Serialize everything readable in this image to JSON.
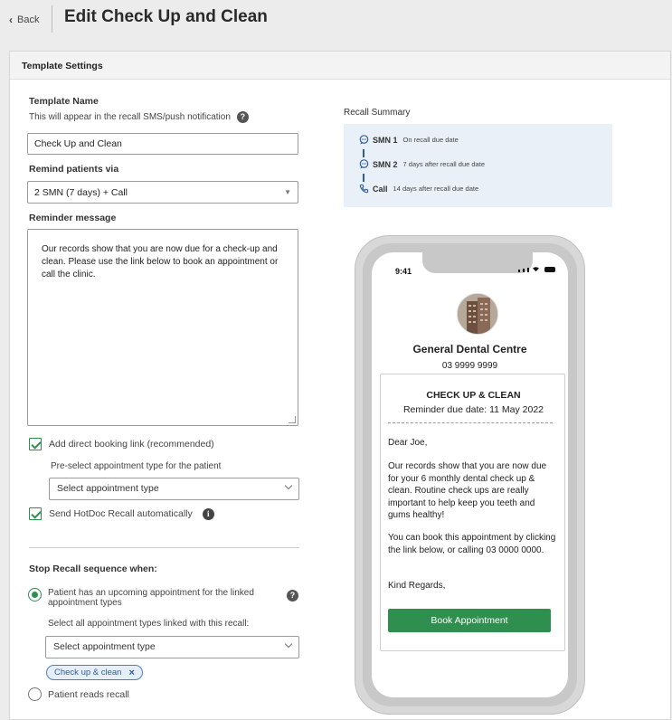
{
  "header": {
    "back_label": "Back",
    "title": "Edit Check Up and Clean"
  },
  "panel": {
    "title": "Template Settings"
  },
  "template_name": {
    "label": "Template Name",
    "help_text": "This will appear in the recall SMS/push notification",
    "value": "Check Up and Clean"
  },
  "remind_via": {
    "label": "Remind patients via",
    "selected": "2 SMN (7 days) + Call"
  },
  "reminder_message": {
    "label": "Reminder message",
    "text": "Our records show that you are now due for a check-up and clean. Please use the link below to book an appointment or call the clinic."
  },
  "booking_link": {
    "checkbox_label": "Add direct booking link (recommended)",
    "preselect_label": "Pre-select appointment type for the patient",
    "preselect_placeholder": "Select appointment type"
  },
  "auto_send": {
    "checkbox_label": "Send HotDoc Recall automatically"
  },
  "stop_recall": {
    "label": "Stop Recall sequence when:",
    "option1_line1": "Patient has an upcoming appointment for the linked",
    "option1_line2": "appointment types",
    "linked_label": "Select all appointment types linked with this recall:",
    "linked_placeholder": "Select appointment type",
    "chips": [
      "Check up & clean"
    ],
    "option2": "Patient reads recall"
  },
  "recall_summary": {
    "title": "Recall Summary",
    "items": [
      {
        "name": "SMN 1",
        "desc": "On recall due date",
        "icon": "chat-bubble-icon"
      },
      {
        "name": "SMN 2",
        "desc": "7 days after recall due date",
        "icon": "chat-bubble-icon"
      },
      {
        "name": "Call",
        "desc": "14 days after recall due date",
        "icon": "phone-icon"
      }
    ]
  },
  "phone_preview": {
    "time": "9:41",
    "clinic_name": "General Dental Centre",
    "clinic_phone": "03 9999 9999",
    "card_title": "CHECK UP & CLEAN",
    "due_date": "Reminder due date: 11 May 2022",
    "greeting": "Dear Joe,",
    "body1": "Our records show that you are now due for your 6 monthly dental check up & clean. Routine check ups are really important to help keep you teeth and gums healthy!",
    "body2": "You can book this appointment by clicking the link below, or calling 03 0000 0000.",
    "signoff": "Kind Regards,",
    "button_label": "Book Appointment"
  },
  "colors": {
    "accent_green": "#2f8f4e",
    "chip_blue": "#2d5e9b",
    "summary_bg": "#eaf0f7"
  }
}
